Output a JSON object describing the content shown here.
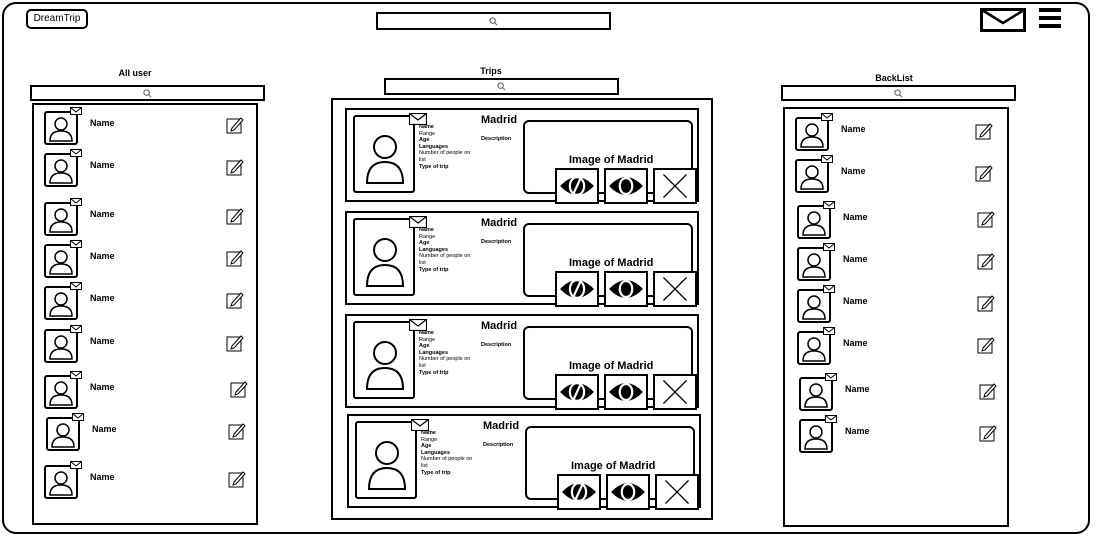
{
  "header": {
    "logo_label": "DreamTrip",
    "search_icon": "search-icon",
    "mail_icon": "mail-icon",
    "menu_icon": "hamburger-menu-icon"
  },
  "all_users": {
    "title": "All user",
    "users": [
      {
        "name": "Name"
      },
      {
        "name": "Name"
      },
      {
        "name": "Name"
      },
      {
        "name": "Name"
      },
      {
        "name": "Name"
      },
      {
        "name": "Name"
      },
      {
        "name": "Name"
      },
      {
        "name": "Name"
      },
      {
        "name": "Name"
      }
    ]
  },
  "trips": {
    "title": "Trips",
    "cards": [
      {
        "city": "Madrid",
        "name": "Name",
        "range": "Range",
        "age": "Age",
        "languages": "Languages",
        "people": "Number of people on",
        "list": "list",
        "type": "Type of trip",
        "description_label": "Description",
        "image_label": "Image of Madrid"
      },
      {
        "city": "Madrid",
        "name": "Name",
        "range": "Range",
        "age": "Age",
        "languages": "Languages",
        "people": "Number of people on",
        "list": "list",
        "type": "Type of trip",
        "description_label": "Description",
        "image_label": "Image of Madrid"
      },
      {
        "city": "Madrid",
        "name": "Name",
        "range": "Range",
        "age": "Age",
        "languages": "Languages",
        "people": "Number of people on",
        "list": "list",
        "type": "Type of trip",
        "description_label": "Description",
        "image_label": "Image of Madrid"
      },
      {
        "city": "Madrid",
        "name": "Name",
        "range": "Range",
        "age": "Age",
        "languages": "Languages",
        "people": "Number of people on",
        "list": "list",
        "type": "Type of trip",
        "description_label": "Description",
        "image_label": "Image of Madrid"
      }
    ]
  },
  "blacklist": {
    "title": "BackList",
    "users": [
      {
        "name": "Name"
      },
      {
        "name": "Name"
      },
      {
        "name": "Name"
      },
      {
        "name": "Name"
      },
      {
        "name": "Name"
      },
      {
        "name": "Name"
      },
      {
        "name": "Name"
      },
      {
        "name": "Name"
      }
    ]
  }
}
